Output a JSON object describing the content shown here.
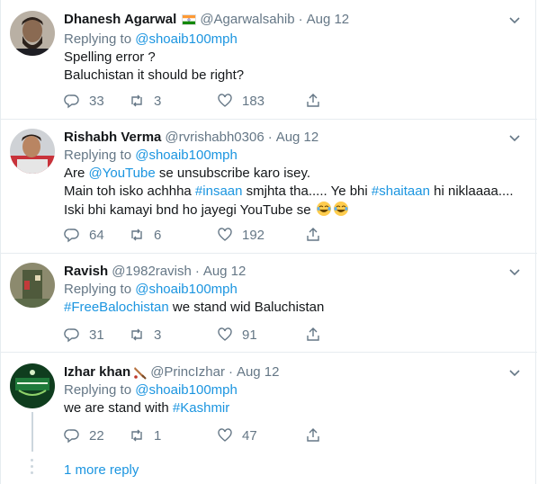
{
  "colors": {
    "link": "#1b95e0",
    "meta": "#657786",
    "text": "#14171a",
    "divider": "#e6ecf0"
  },
  "replying_label": "Replying to",
  "tweets": [
    {
      "name": "Dhanesh Agarwal",
      "handle": "@Agarwalsahib",
      "dot": "·",
      "time": "Aug 12",
      "replying_to": "@shoaib100mph",
      "lines": [
        "Spelling error ?",
        "Baluchistan it should be right?"
      ],
      "replies": "33",
      "retweets": "3",
      "likes": "183"
    },
    {
      "name": "Rishabh Verma",
      "handle": "@rvrishabh0306",
      "dot": "·",
      "time": "Aug 12",
      "replying_to": "@shoaib100mph",
      "line1_pre": "Are ",
      "line1_link": "@YouTube",
      "line1_post": " se unsubscribe karo isey.",
      "line2_pre": "Main toh isko achhha ",
      "line2_link1": "#insaan",
      "line2_mid": " smjhta tha..... Ye bhi ",
      "line2_link2": "#shaitaan",
      "line2_post": " hi niklaaaa....",
      "line3": "Iski bhi kamayi bnd ho jayegi YouTube se",
      "replies": "64",
      "retweets": "6",
      "likes": "192"
    },
    {
      "name": "Ravish",
      "handle": "@1982ravish",
      "dot": "·",
      "time": "Aug 12",
      "replying_to": "@shoaib100mph",
      "line1_link": "#FreeBalochistan",
      "line1_post": " we stand wid Baluchistan",
      "replies": "31",
      "retweets": "3",
      "likes": "91"
    },
    {
      "name": "Izhar khan",
      "handle": "@PrincIzhar",
      "dot": "·",
      "time": "Aug 12",
      "replying_to": "@shoaib100mph",
      "line1_pre": "we are stand with ",
      "line1_link": "#Kashmir",
      "replies": "22",
      "retweets": "1",
      "likes": "47"
    }
  ],
  "more_reply": "1 more reply"
}
